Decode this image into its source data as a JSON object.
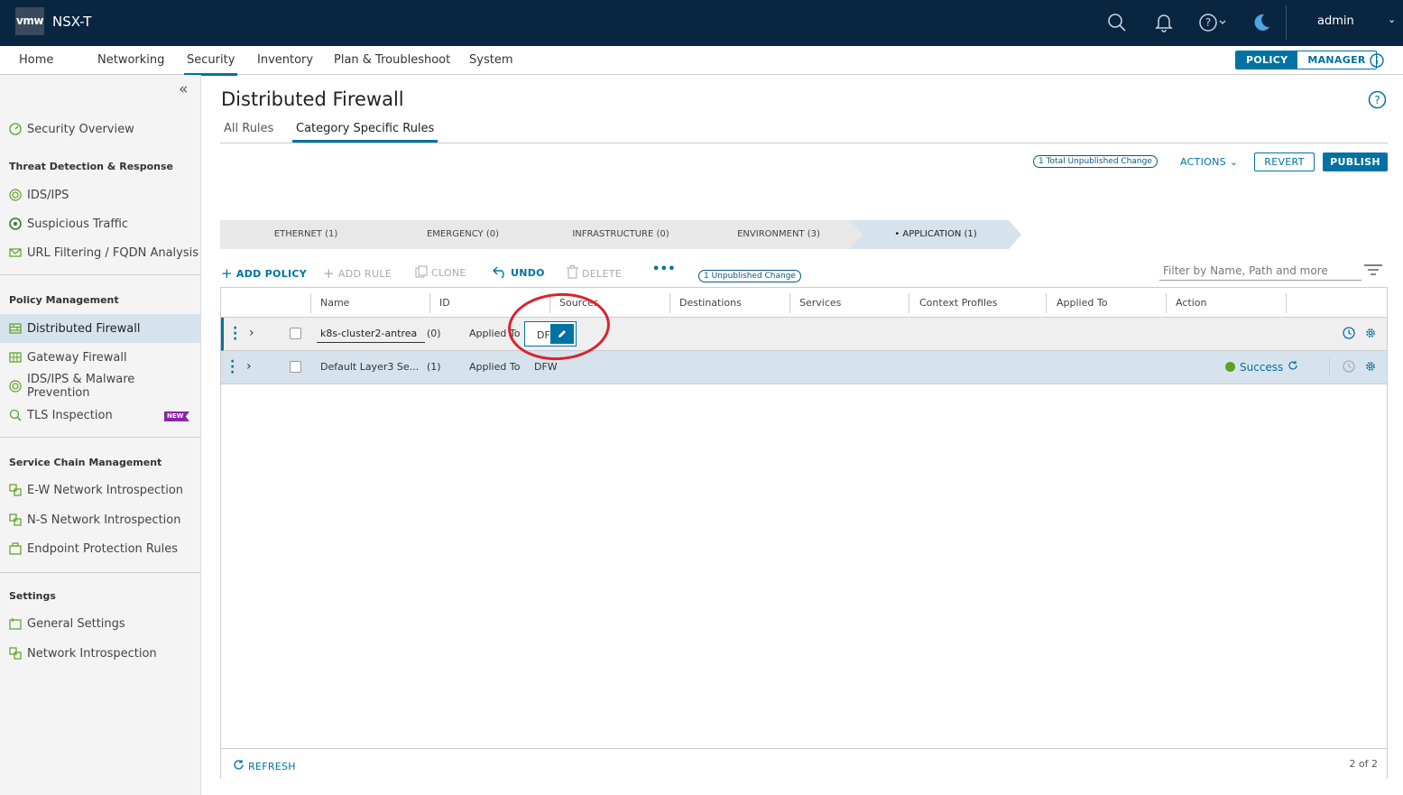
{
  "header": {
    "logo": "vmw",
    "product": "NSX-T",
    "user": "admin",
    "user_chevron": "⌄",
    "icons": [
      "search-icon",
      "bell-icon",
      "help-icon",
      "moon-icon"
    ]
  },
  "nav": {
    "items": [
      "Home",
      "Networking",
      "Security",
      "Inventory",
      "Plan & Troubleshoot",
      "System"
    ],
    "active": "Security",
    "mode_policy": "POLICY",
    "mode_manager": "MANAGER"
  },
  "sidebar": {
    "collapse": "«",
    "top_item": "Security Overview",
    "sections": [
      {
        "title": "Threat Detection & Response",
        "items": [
          "IDS/IPS",
          "Suspicious Traffic",
          "URL Filtering / FQDN Analysis"
        ]
      },
      {
        "title": "Policy Management",
        "items": [
          "Distributed Firewall",
          "Gateway Firewall",
          "IDS/IPS & Malware Prevention",
          "TLS Inspection"
        ]
      },
      {
        "title": "Service Chain Management",
        "items": [
          "E-W Network Introspection",
          "N-S Network Introspection",
          "Endpoint Protection Rules"
        ]
      },
      {
        "title": "Settings",
        "items": [
          "General Settings",
          "Network Introspection"
        ]
      }
    ],
    "new_badge": "NEW",
    "accent": "#5aa220"
  },
  "main": {
    "title": "Distributed Firewall",
    "tabs": [
      "All Rules",
      "Category Specific Rules"
    ],
    "active_tab": "Category Specific Rules",
    "unpublished_total": "1 Total Unpublished Change",
    "actions": "ACTIONS",
    "actions_chevron": "⌄",
    "revert": "REVERT",
    "publish": "PUBLISH",
    "categories": [
      "ETHERNET (1)",
      "EMERGENCY (0)",
      "INFRASTRUCTURE (0)",
      "ENVIRONMENT (3)",
      "• APPLICATION (1)"
    ],
    "toolbar": {
      "add_policy": "ADD POLICY",
      "add_rule": "ADD RULE",
      "clone": "CLONE",
      "undo": "UNDO",
      "delete": "DELETE",
      "more": "•••",
      "unpublished": "1 Unpublished Change",
      "filter_placeholder": "Filter by Name, Path and more"
    },
    "columns": [
      "Name",
      "ID",
      "Sources",
      "Destinations",
      "Services",
      "Context Profiles",
      "Applied To",
      "Action"
    ],
    "rows": [
      {
        "name": "k8s-cluster2-antrea",
        "id": "(0)",
        "applied_label": "Applied To",
        "applied_value": "DF",
        "editing": true
      },
      {
        "name": "Default Layer3 Se...",
        "id": "(1)",
        "applied_label": "Applied To",
        "applied_value": "DFW",
        "status": "Success"
      }
    ],
    "footer": {
      "refresh": "REFRESH",
      "count": "2 of 2"
    },
    "accent": "#0072a3",
    "annotation_color": "#d9232e"
  }
}
